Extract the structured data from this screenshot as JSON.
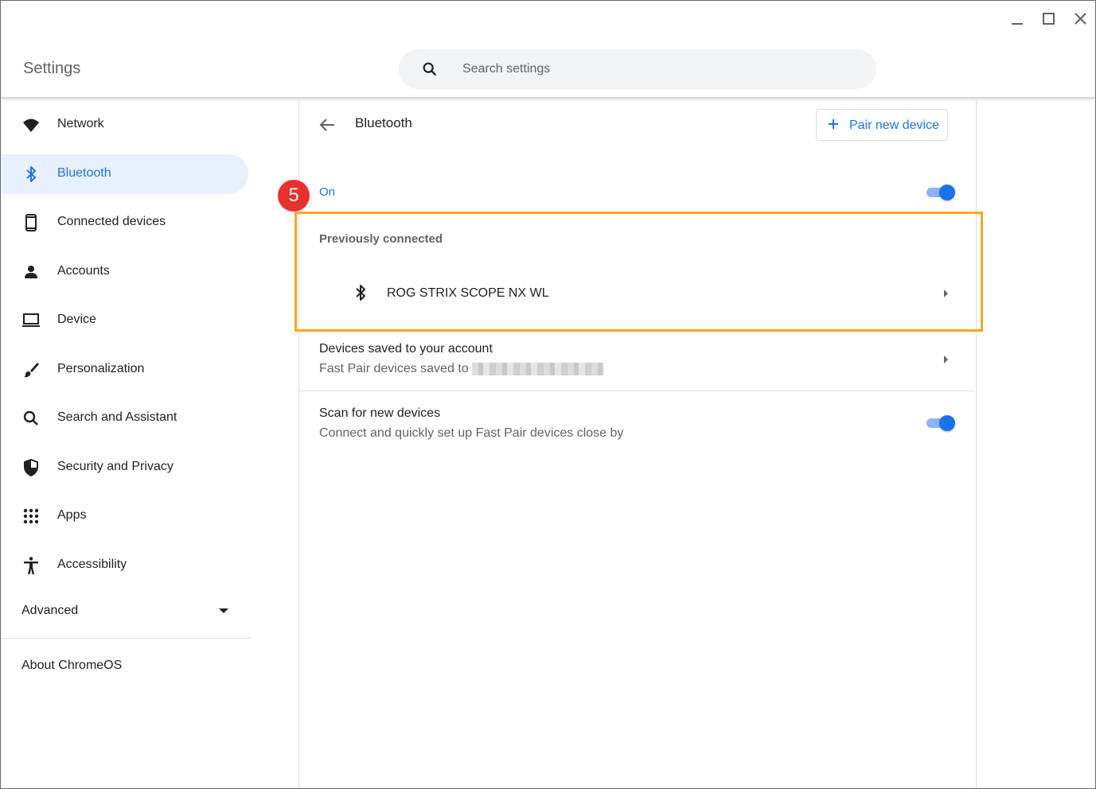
{
  "window": {
    "title": "Settings",
    "controls": [
      "minimize-icon",
      "maximize-icon",
      "close-icon"
    ]
  },
  "search": {
    "placeholder": "Search settings"
  },
  "sidebar": {
    "items": [
      {
        "label": "Network",
        "icon": "wifi-icon",
        "active": false
      },
      {
        "label": "Bluetooth",
        "icon": "bluetooth-icon",
        "active": true
      },
      {
        "label": "Connected devices",
        "icon": "phone-icon",
        "active": false
      },
      {
        "label": "Accounts",
        "icon": "person-icon",
        "active": false
      },
      {
        "label": "Device",
        "icon": "laptop-icon",
        "active": false
      },
      {
        "label": "Personalization",
        "icon": "brush-icon",
        "active": false
      },
      {
        "label": "Search and Assistant",
        "icon": "search-icon",
        "active": false
      },
      {
        "label": "Security and Privacy",
        "icon": "shield-icon",
        "active": false
      },
      {
        "label": "Apps",
        "icon": "apps-grid-icon",
        "active": false
      },
      {
        "label": "Accessibility",
        "icon": "accessibility-icon",
        "active": false
      }
    ],
    "advanced_label": "Advanced",
    "about_label": "About ChromeOS"
  },
  "main": {
    "title": "Bluetooth",
    "pair_button_label": "Pair new device",
    "step_number": "5",
    "bluetooth_state_label": "On",
    "bluetooth_enabled": true,
    "previously_connected": {
      "heading": "Previously connected",
      "devices": [
        {
          "name": "ROG STRIX SCOPE NX WL",
          "icon": "bluetooth-icon"
        }
      ]
    },
    "saved_devices": {
      "title": "Devices saved to your account",
      "subtitle": "Fast Pair devices saved to"
    },
    "scan": {
      "title": "Scan for new devices",
      "subtitle": "Connect and quickly set up Fast Pair devices close by",
      "enabled": true
    }
  },
  "colors": {
    "accent": "#1a73e8",
    "active_nav_bg": "#e8f0fe",
    "highlight_border": "#f4a91c",
    "step_badge": "#e8302c"
  }
}
